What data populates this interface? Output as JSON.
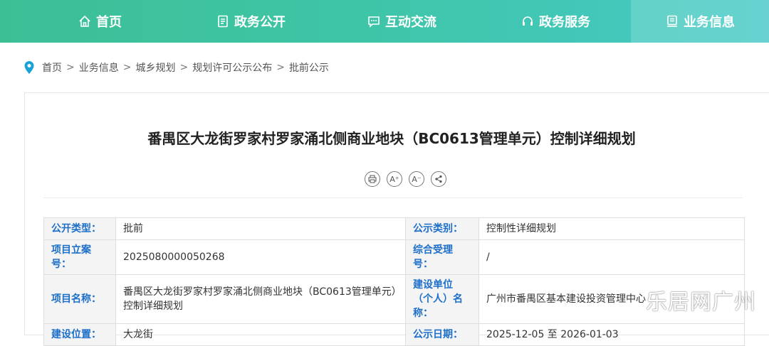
{
  "nav": {
    "items": [
      {
        "label": "首页",
        "icon": "home-icon"
      },
      {
        "label": "政务公开",
        "icon": "document-icon"
      },
      {
        "label": "互动交流",
        "icon": "chat-icon"
      },
      {
        "label": "政务服务",
        "icon": "headset-icon"
      },
      {
        "label": "业务信息",
        "icon": "info-icon"
      }
    ],
    "active": "业务信息"
  },
  "breadcrumb": {
    "icon": "location-pin-icon",
    "items": [
      "首页",
      "业务信息",
      "城乡规划",
      "规划许可公示公布",
      "批前公示"
    ],
    "separator": ">"
  },
  "article": {
    "title": "番禺区大龙街罗家村罗家涌北侧商业地块（BC0613管理单元）控制详细规划",
    "tools": [
      "print-icon",
      "font-increase-icon",
      "font-decrease-icon",
      "share-icon"
    ]
  },
  "info_table": [
    {
      "l1": "公开类型：",
      "v1": "批前",
      "l2": "公示类别：",
      "v2": "控制性详细规划"
    },
    {
      "l1": "项目立案号：",
      "v1": "2025080000050268",
      "l2": "综合受理号：",
      "v2": "/"
    },
    {
      "l1": "项目名称：",
      "v1": "番禺区大龙街罗家村罗家涌北侧商业地块（BC0613管理单元）控制详细规划",
      "l2": "建设单位（个人）名称：",
      "v2": "广州市番禺区基本建设投资管理中心"
    },
    {
      "l1": "建设位置：",
      "v1": "大龙街",
      "l2": "公示日期：",
      "v2": "2025-12-05 至 2026-01-03"
    }
  ],
  "watermark": "乐居网广州",
  "colors": {
    "nav_start": "#3dbf96",
    "nav_end": "#46c9c6",
    "label_blue": "#1e6fc9",
    "pin": "#1aa3d6"
  }
}
